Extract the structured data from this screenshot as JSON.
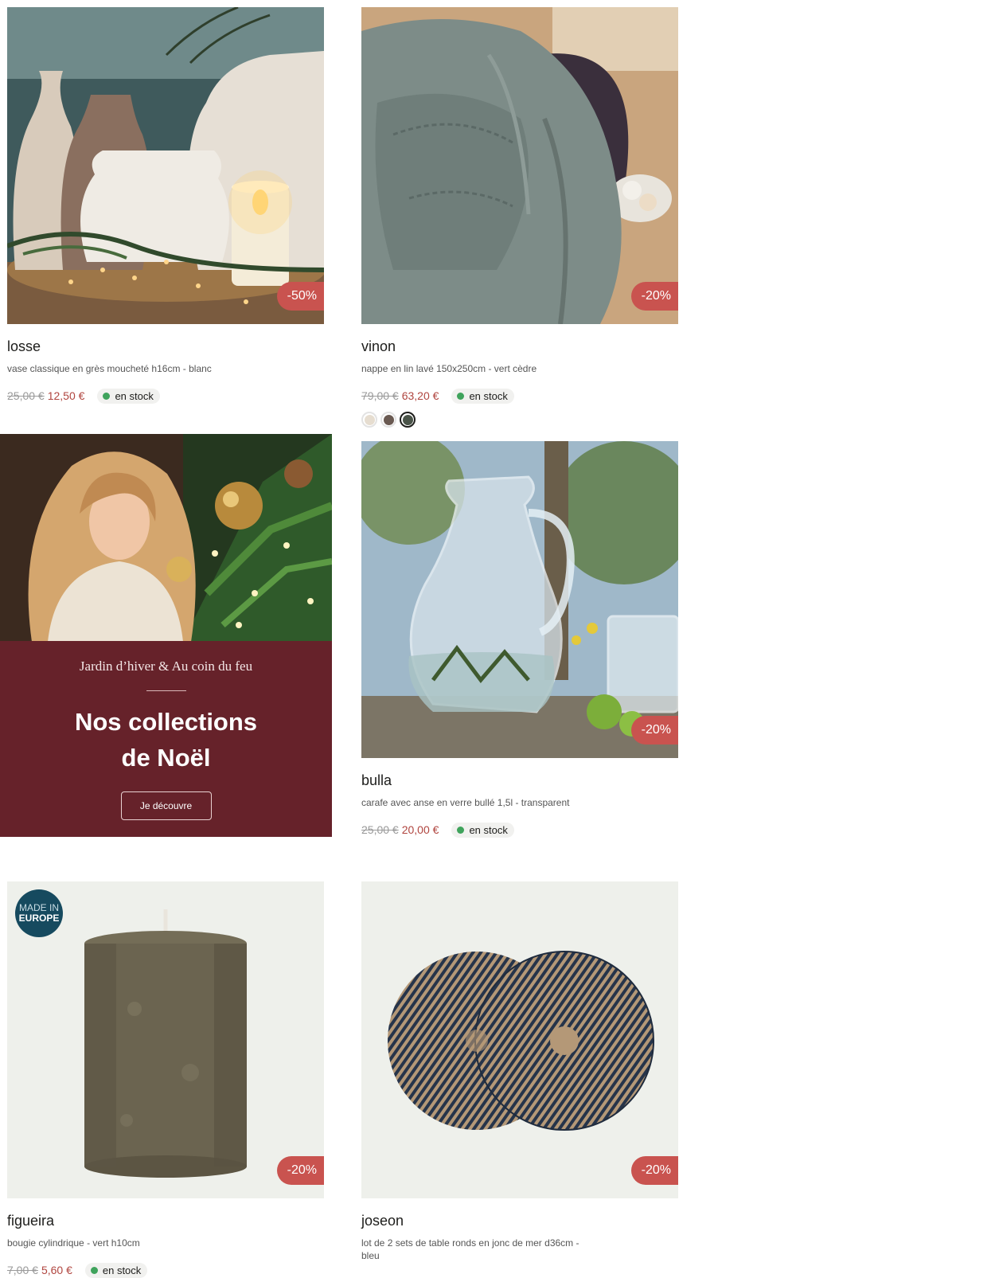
{
  "products": [
    {
      "name": "losse",
      "description": "vase classique en grès moucheté h16cm - blanc",
      "old_price": "25,00 €",
      "new_price": "12,50 €",
      "discount": "-50%",
      "stock": "en stock"
    },
    {
      "name": "vinon",
      "description": "nappe en lin lavé 150x250cm - vert cèdre",
      "old_price": "79,00 €",
      "new_price": "63,20 €",
      "discount": "-20%",
      "stock": "en stock",
      "swatches": [
        "#e6ddd0",
        "#6a5a52",
        "#4a5449"
      ]
    },
    {
      "name": "bulla",
      "description": "carafe avec anse en verre bullé 1,5l - transparent",
      "old_price": "25,00 €",
      "new_price": "20,00 €",
      "discount": "-20%",
      "stock": "en stock"
    },
    {
      "name": "figueira",
      "description": "bougie cylindrique - vert h10cm",
      "old_price": "7,00 €",
      "new_price": "5,60 €",
      "discount": "-20%",
      "stock": "en stock",
      "badge_line1": "MADE IN",
      "badge_line2": "EUROPE"
    },
    {
      "name": "joseon",
      "description": "lot de 2 sets de table ronds en jonc de mer d36cm - bleu",
      "discount": "-20%"
    }
  ],
  "banner": {
    "subtitle": "Jardin d’hiver & Au coin du feu",
    "title_line1": "Nos collections",
    "title_line2": "de Noël",
    "button": "Je découvre",
    "panel_color": "#66222a"
  },
  "colors": {
    "discount_badge": "#c9534f",
    "sale_price": "#b0453f",
    "stock_dot": "#3fa35c"
  }
}
